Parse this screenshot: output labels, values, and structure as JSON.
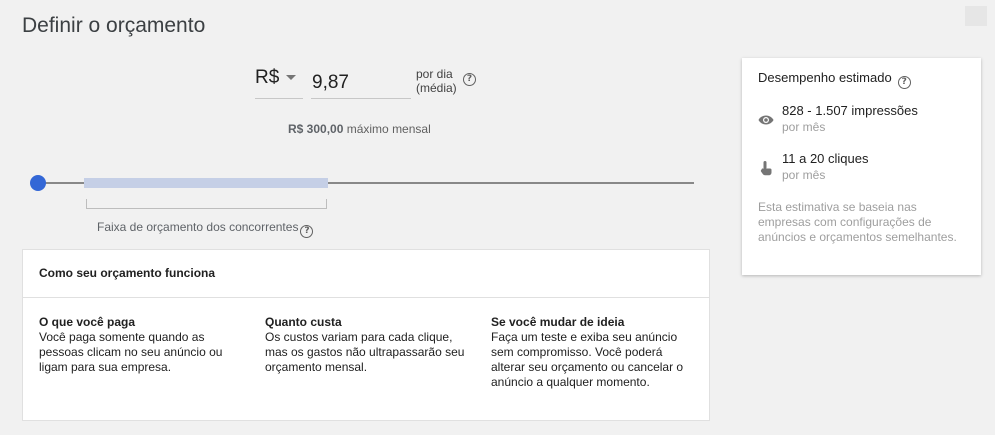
{
  "page": {
    "title": "Definir o orçamento"
  },
  "budget": {
    "currency": "R$",
    "amount": "9,87",
    "period_line1": "por dia",
    "period_line2": "(média)",
    "monthly_max_value": "R$ 300,00",
    "monthly_max_label": " máximo mensal",
    "slider_position": 0.0,
    "competitor_range_label": "Faixa de orçamento dos concorrentes"
  },
  "how_it_works": {
    "title": "Como seu orçamento funciona",
    "columns": [
      {
        "heading": "O que você paga",
        "text": "Você paga somente quando as pessoas clicam no seu anúncio ou ligam para sua empresa."
      },
      {
        "heading": "Quanto custa",
        "text": "Os custos variam para cada clique, mas os gastos não ultrapassarão seu orçamento mensal."
      },
      {
        "heading": "Se você mudar de ideia",
        "text": "Faça um teste e exiba seu anúncio sem compromisso. Você poderá alterar seu orçamento ou cancelar o anúncio a qualquer momento."
      }
    ]
  },
  "performance": {
    "title": "Desempenho estimado",
    "metrics": [
      {
        "icon": "eye-icon",
        "value": "828 - 1.507 impressões",
        "sub": "por mês"
      },
      {
        "icon": "touch-icon",
        "value": "11 a 20 cliques",
        "sub": "por mês"
      }
    ],
    "note": "Esta estimativa se baseia nas empresas com configurações de anúncios e orçamentos semelhantes."
  },
  "colors": {
    "accent": "#3367d6",
    "range": "#c5cfe6",
    "background": "#f1f1f1"
  }
}
